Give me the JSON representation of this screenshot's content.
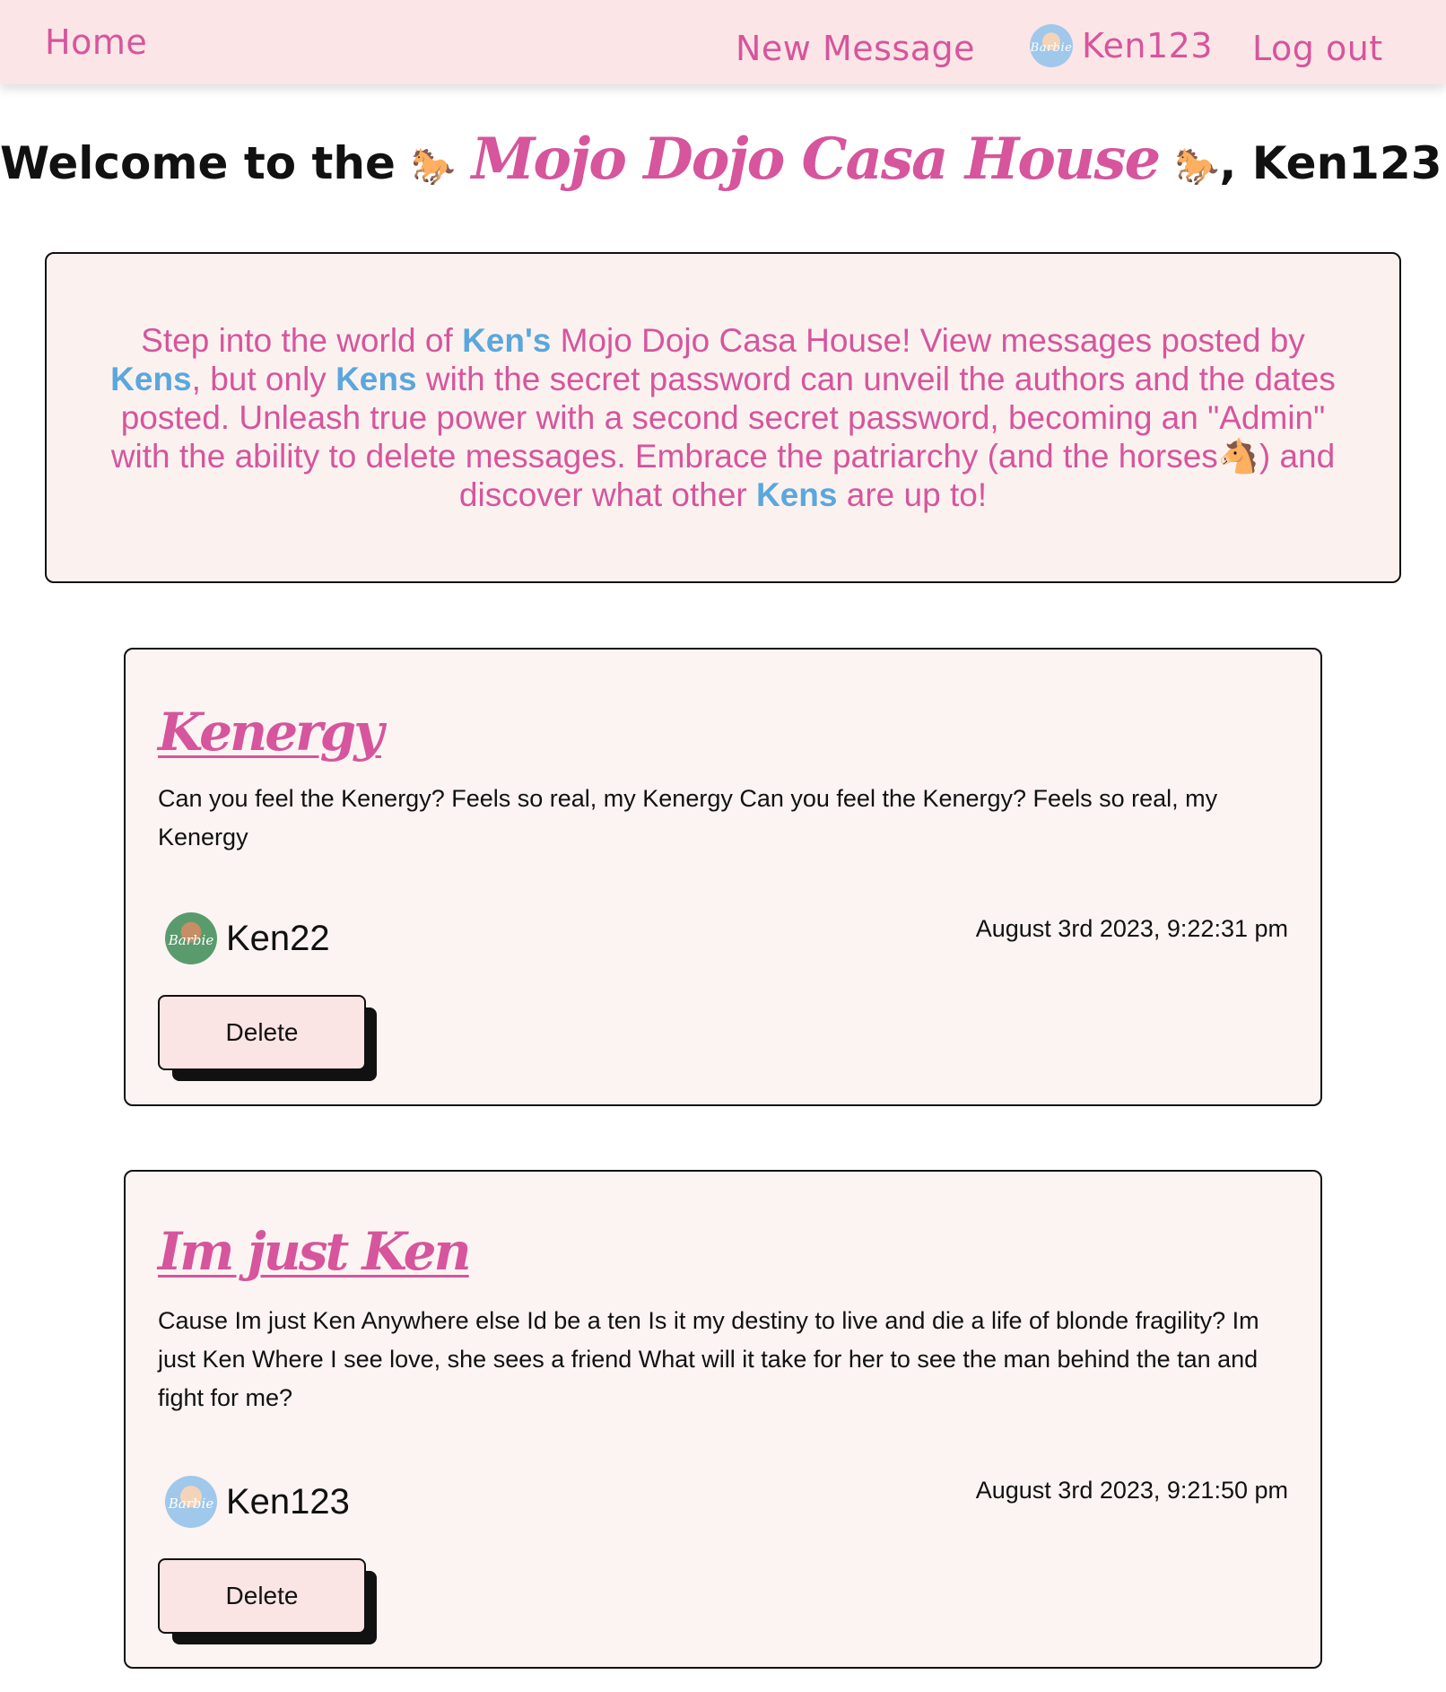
{
  "nav": {
    "home_label": "Home",
    "new_message_label": "New Message",
    "username": "Ken123",
    "logout_label": "Log out",
    "avatar_text": "Barbie"
  },
  "welcome": {
    "prefix": "Welcome to the",
    "brand": "Mojo Dojo Casa House",
    "suffix": ", Ken123 !",
    "horse_emoji": "🐎"
  },
  "intro": {
    "t1": "Step into the world of ",
    "k1": "Ken's",
    "t2": " Mojo Dojo Casa House! View messages posted by ",
    "k2": "Kens",
    "t3": ", but only ",
    "k3": "Kens",
    "t4": " with the secret password can unveil the authors and the dates posted. Unleash true power with a second secret password, becoming an \"Admin\" with the ability to delete messages. Embrace the patriarchy (and the horses🐴) and discover what other ",
    "k4": "Kens",
    "t5": " are up to!"
  },
  "messages": [
    {
      "title": "Kenergy",
      "body": "Can you feel the Kenergy? Feels so real, my Kenergy Can you feel the Kenergy? Feels so real, my Kenergy",
      "author": "Ken22",
      "date": "August 3rd 2023, 9:22:31 pm",
      "delete_label": "Delete"
    },
    {
      "title": "Im just Ken",
      "body": "Cause Im just Ken Anywhere else Id be a ten Is it my destiny to live and die a life of blonde fragility? Im just Ken Where I see love, she sees a friend What will it take for her to see the man behind the tan and fight for me?",
      "author": "Ken123",
      "date": "August 3rd 2023, 9:21:50 pm",
      "delete_label": "Delete"
    }
  ],
  "colors": {
    "accent_pink": "#d6559c",
    "ken_blue": "#5aa7dd",
    "nav_bg": "#fbe5e6",
    "card_bg": "#fbf4f2"
  }
}
